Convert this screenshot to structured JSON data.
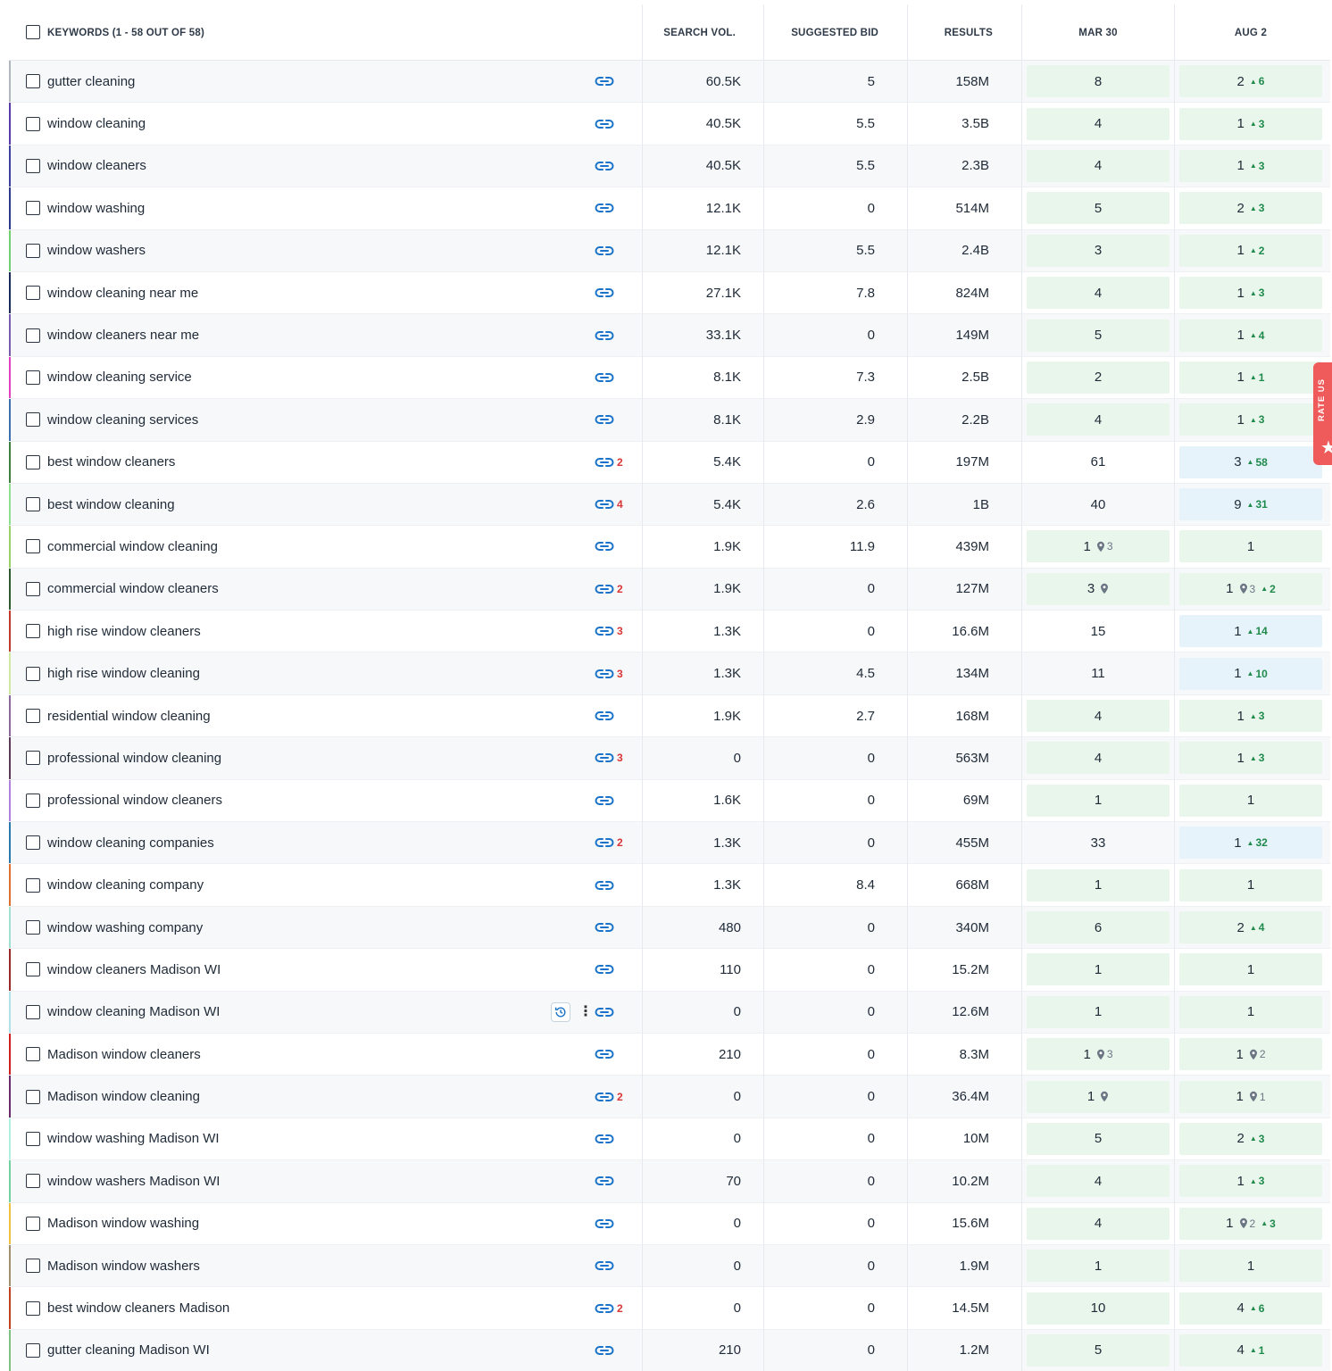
{
  "header": {
    "keywords_label": "KEYWORDS (1 - 58 OUT OF 58)",
    "search_vol": "SEARCH VOL.",
    "suggested_bid": "SUGGESTED BID",
    "results": "RESULTS",
    "date1": "MAR 30",
    "date2": "AUG 2"
  },
  "side_tab": {
    "label": "RATE US",
    "icon": "star-icon",
    "color": "#ef5a5a"
  },
  "colors": {
    "link": "#1a73c9",
    "green_cell": "#e9f6ec",
    "blue_cell": "#e6f3fb",
    "delta": "#1f8a4c",
    "count": "#d93636"
  },
  "rows": [
    {
      "kw": "gutter cleaning",
      "links": "",
      "vol": "60.5K",
      "bid": "5",
      "results": "158M",
      "r1": "8",
      "r1_bg": "green",
      "r2": "2",
      "r2_delta": "6",
      "r2_bg": "green",
      "bar": "#b0b6bd"
    },
    {
      "kw": "window cleaning",
      "links": "",
      "vol": "40.5K",
      "bid": "5.5",
      "results": "3.5B",
      "r1": "4",
      "r1_bg": "green",
      "r2": "1",
      "r2_delta": "3",
      "r2_bg": "green",
      "bar": "#5a3aa8"
    },
    {
      "kw": "window cleaners",
      "links": "",
      "vol": "40.5K",
      "bid": "5.5",
      "results": "2.3B",
      "r1": "4",
      "r1_bg": "green",
      "r2": "1",
      "r2_delta": "3",
      "r2_bg": "green",
      "bar": "#3b3f9e"
    },
    {
      "kw": "window washing",
      "links": "",
      "vol": "12.1K",
      "bid": "0",
      "results": "514M",
      "r1": "5",
      "r1_bg": "green",
      "r2": "2",
      "r2_delta": "3",
      "r2_bg": "green",
      "bar": "#2d3a8c"
    },
    {
      "kw": "window washers",
      "links": "",
      "vol": "12.1K",
      "bid": "5.5",
      "results": "2.4B",
      "r1": "3",
      "r1_bg": "green",
      "r2": "1",
      "r2_delta": "2",
      "r2_bg": "green",
      "bar": "#6fd06f"
    },
    {
      "kw": "window cleaning near me",
      "links": "",
      "vol": "27.1K",
      "bid": "7.8",
      "results": "824M",
      "r1": "4",
      "r1_bg": "green",
      "r2": "1",
      "r2_delta": "3",
      "r2_bg": "green",
      "bar": "#1a2a5c"
    },
    {
      "kw": "window cleaners near me",
      "links": "",
      "vol": "33.1K",
      "bid": "0",
      "results": "149M",
      "r1": "5",
      "r1_bg": "green",
      "r2": "1",
      "r2_delta": "4",
      "r2_bg": "green",
      "bar": "#7a5cae"
    },
    {
      "kw": "window cleaning service",
      "links": "",
      "vol": "8.1K",
      "bid": "7.3",
      "results": "2.5B",
      "r1": "2",
      "r1_bg": "green",
      "r2": "1",
      "r2_delta": "1",
      "r2_bg": "green",
      "bar": "#e040c0"
    },
    {
      "kw": "window cleaning services",
      "links": "",
      "vol": "8.1K",
      "bid": "2.9",
      "results": "2.2B",
      "r1": "4",
      "r1_bg": "green",
      "r2": "1",
      "r2_delta": "3",
      "r2_bg": "green",
      "bar": "#3a6fb0"
    },
    {
      "kw": "best window cleaners",
      "links": "2",
      "vol": "5.4K",
      "bid": "0",
      "results": "197M",
      "r1": "61",
      "r1_bg": "",
      "r2": "3",
      "r2_delta": "58",
      "r2_bg": "blue",
      "bar": "#3f7d3f"
    },
    {
      "kw": "best window cleaning",
      "links": "4",
      "vol": "5.4K",
      "bid": "2.6",
      "results": "1B",
      "r1": "40",
      "r1_bg": "",
      "r2": "9",
      "r2_delta": "31",
      "r2_bg": "blue",
      "bar": "#8ee08e"
    },
    {
      "kw": "commercial window cleaning",
      "links": "",
      "vol": "1.9K",
      "bid": "11.9",
      "results": "439M",
      "r1": "1",
      "r1_pin": "3",
      "r1_bg": "green",
      "r2": "1",
      "r2_bg": "green",
      "bar": "#9ad06a"
    },
    {
      "kw": "commercial window cleaners",
      "links": "2",
      "vol": "1.9K",
      "bid": "0",
      "results": "127M",
      "r1": "3",
      "r1_pin": "",
      "r1_bg": "green",
      "r2": "1",
      "r2_pin": "3",
      "r2_delta": "2",
      "r2_bg": "green",
      "bar": "#2f5a2f"
    },
    {
      "kw": "high rise window cleaners",
      "links": "3",
      "vol": "1.3K",
      "bid": "0",
      "results": "16.6M",
      "r1": "15",
      "r1_bg": "",
      "r2": "1",
      "r2_delta": "14",
      "r2_bg": "blue",
      "bar": "#c0392b"
    },
    {
      "kw": "high rise window cleaning",
      "links": "3",
      "vol": "1.3K",
      "bid": "4.5",
      "results": "134M",
      "r1": "11",
      "r1_bg": "",
      "r2": "1",
      "r2_delta": "10",
      "r2_bg": "blue",
      "bar": "#d0e8a0"
    },
    {
      "kw": "residential window cleaning",
      "links": "",
      "vol": "1.9K",
      "bid": "2.7",
      "results": "168M",
      "r1": "4",
      "r1_bg": "green",
      "r2": "1",
      "r2_delta": "3",
      "r2_bg": "green",
      "bar": "#8a6a9a"
    },
    {
      "kw": "professional window cleaning",
      "links": "3",
      "vol": "0",
      "bid": "0",
      "results": "563M",
      "r1": "4",
      "r1_bg": "green",
      "r2": "1",
      "r2_delta": "3",
      "r2_bg": "green",
      "bar": "#5c3a5c"
    },
    {
      "kw": "professional window cleaners",
      "links": "",
      "vol": "1.6K",
      "bid": "0",
      "results": "69M",
      "r1": "1",
      "r1_bg": "green",
      "r2": "1",
      "r2_bg": "green",
      "bar": "#b080e0"
    },
    {
      "kw": "window cleaning companies",
      "links": "2",
      "vol": "1.3K",
      "bid": "0",
      "results": "455M",
      "r1": "33",
      "r1_bg": "",
      "r2": "1",
      "r2_delta": "32",
      "r2_bg": "blue",
      "bar": "#2a7ab0"
    },
    {
      "kw": "window cleaning company",
      "links": "",
      "vol": "1.3K",
      "bid": "8.4",
      "results": "668M",
      "r1": "1",
      "r1_bg": "green",
      "r2": "1",
      "r2_bg": "green",
      "bar": "#e07030"
    },
    {
      "kw": "window washing company",
      "links": "",
      "vol": "480",
      "bid": "0",
      "results": "340M",
      "r1": "6",
      "r1_bg": "green",
      "r2": "2",
      "r2_delta": "4",
      "r2_bg": "green",
      "bar": "#a0e0d0"
    },
    {
      "kw": "window cleaners Madison WI",
      "links": "",
      "vol": "110",
      "bid": "0",
      "results": "15.2M",
      "r1": "1",
      "r1_bg": "green",
      "r2": "1",
      "r2_bg": "green",
      "bar": "#9a2a2a"
    },
    {
      "kw": "window cleaning Madison WI",
      "links": "",
      "vol": "0",
      "bid": "0",
      "results": "12.6M",
      "r1": "1",
      "r1_bg": "green",
      "r2": "1",
      "r2_bg": "green",
      "bar": "#b0e0e8",
      "hover": true
    },
    {
      "kw": "Madison window cleaners",
      "links": "",
      "vol": "210",
      "bid": "0",
      "results": "8.3M",
      "r1": "1",
      "r1_pin": "3",
      "r1_bg": "green",
      "r2": "1",
      "r2_pin": "2",
      "r2_bg": "green",
      "bar": "#d02020"
    },
    {
      "kw": "Madison window cleaning",
      "links": "2",
      "vol": "0",
      "bid": "0",
      "results": "36.4M",
      "r1": "1",
      "r1_pin": "",
      "r1_bg": "green",
      "r2": "1",
      "r2_pin": "1",
      "r2_bg": "green",
      "bar": "#6a2a6a"
    },
    {
      "kw": "window washing Madison WI",
      "links": "",
      "vol": "0",
      "bid": "0",
      "results": "10M",
      "r1": "5",
      "r1_bg": "green",
      "r2": "2",
      "r2_delta": "3",
      "r2_bg": "green",
      "bar": "#b0f0e0"
    },
    {
      "kw": "window washers Madison WI",
      "links": "",
      "vol": "70",
      "bid": "0",
      "results": "10.2M",
      "r1": "4",
      "r1_bg": "green",
      "r2": "1",
      "r2_delta": "3",
      "r2_bg": "green",
      "bar": "#70d0a0"
    },
    {
      "kw": "Madison window washing",
      "links": "",
      "vol": "0",
      "bid": "0",
      "results": "15.6M",
      "r1": "4",
      "r1_bg": "green",
      "r2": "1",
      "r2_pin": "2",
      "r2_delta": "3",
      "r2_bg": "green",
      "bar": "#f0c040"
    },
    {
      "kw": "Madison window washers",
      "links": "",
      "vol": "0",
      "bid": "0",
      "results": "1.9M",
      "r1": "1",
      "r1_bg": "green",
      "r2": "1",
      "r2_bg": "green",
      "bar": "#a09070"
    },
    {
      "kw": "best window cleaners Madison",
      "links": "2",
      "vol": "0",
      "bid": "0",
      "results": "14.5M",
      "r1": "10",
      "r1_bg": "green",
      "r2": "4",
      "r2_delta": "6",
      "r2_bg": "green",
      "bar": "#c04020"
    },
    {
      "kw": "gutter cleaning Madison WI",
      "links": "",
      "vol": "210",
      "bid": "0",
      "results": "1.2M",
      "r1": "5",
      "r1_bg": "green",
      "r2": "4",
      "r2_delta": "1",
      "r2_bg": "green",
      "bar": "#80c080"
    }
  ]
}
